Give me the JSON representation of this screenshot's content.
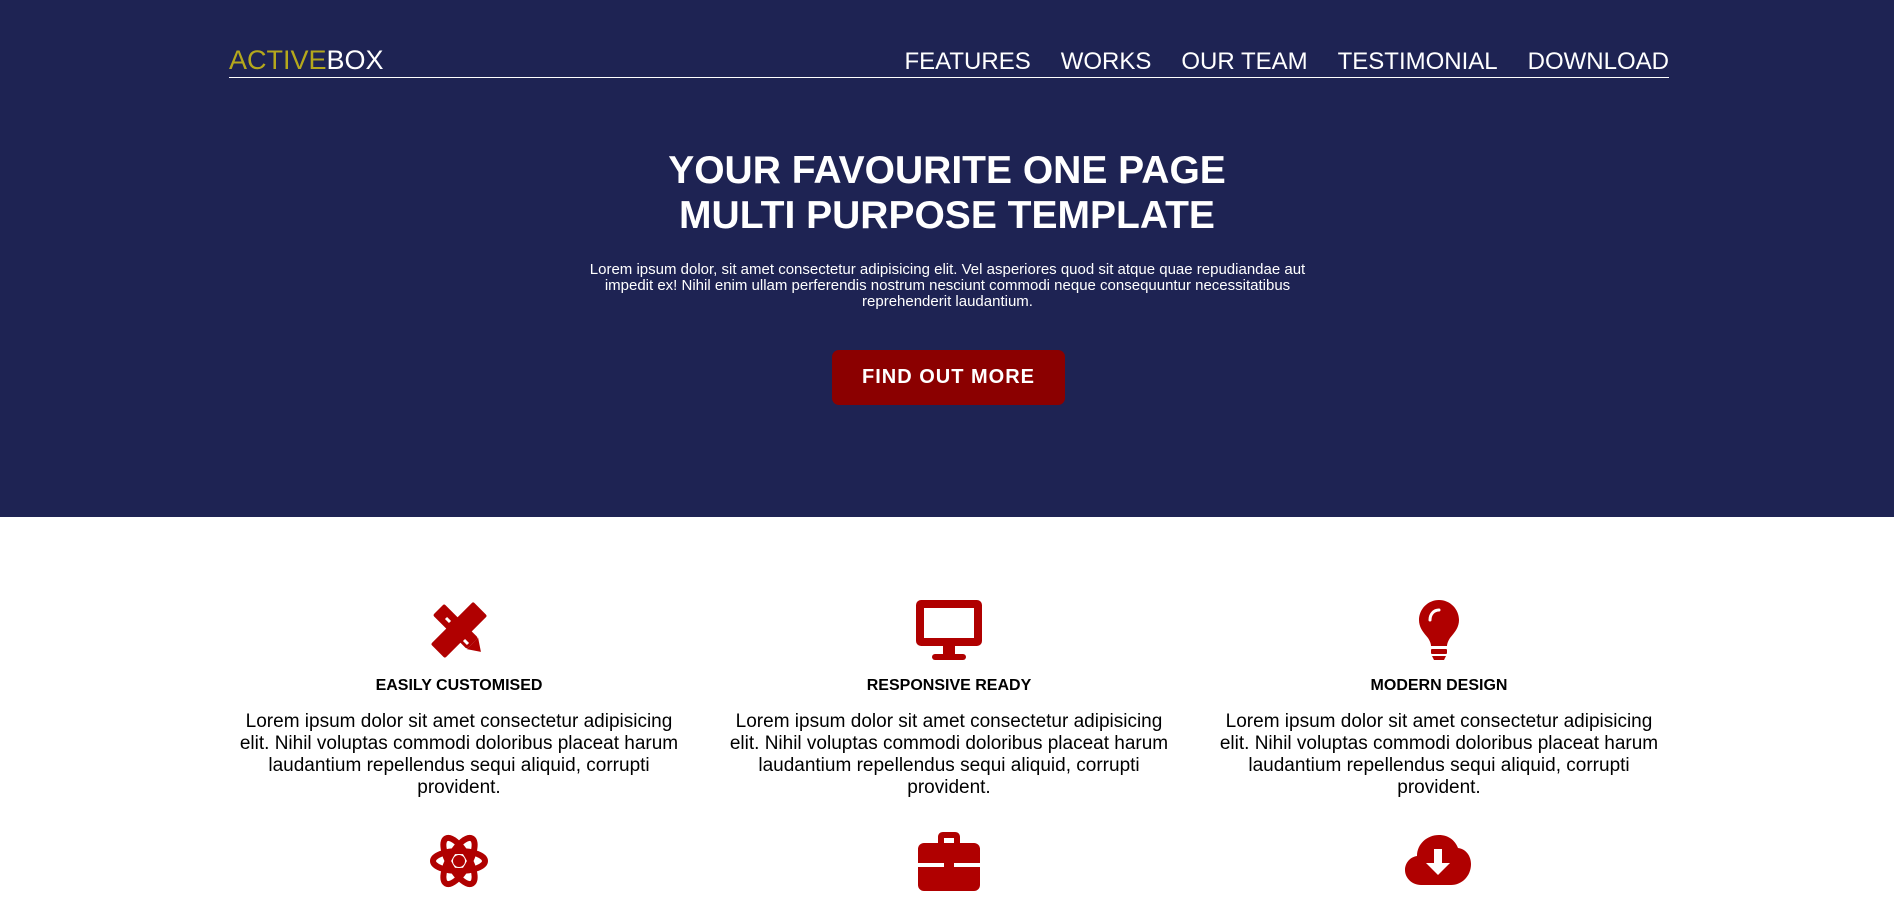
{
  "logo": {
    "part1": "ACTIVE",
    "part2": "BOX"
  },
  "nav": [
    "FEATURES",
    "WORKS",
    "OUR TEAM",
    "TESTIMONIAL",
    "DOWNLOAD"
  ],
  "hero": {
    "title_line1": "YOUR FAVOURITE ONE PAGE",
    "title_line2": "MULTI PURPOSE TEMPLATE",
    "text": "Lorem ipsum dolor, sit amet consectetur adipisicing elit. Vel asperiores quod sit atque quae repudiandae aut impedit ex! Nihil enim ullam perferendis nostrum nesciunt commodi neque consequuntur necessitatibus reprehenderit laudantium.",
    "cta": "FIND OUT MORE"
  },
  "features": [
    {
      "icon": "pencil-ruler-icon",
      "title": "EASILY CUSTOMISED",
      "text": "Lorem ipsum dolor sit amet consectetur adipisicing elit. Nihil voluptas commodi doloribus placeat harum laudantium repellendus sequi aliquid, corrupti provident."
    },
    {
      "icon": "desktop-icon",
      "title": "RESPONSIVE READY",
      "text": "Lorem ipsum dolor sit amet consectetur adipisicing elit. Nihil voluptas commodi doloribus placeat harum laudantium repellendus sequi aliquid, corrupti provident."
    },
    {
      "icon": "lightbulb-icon",
      "title": "MODERN DESIGN",
      "text": "Lorem ipsum dolor sit amet consectetur adipisicing elit. Nihil voluptas commodi doloribus placeat harum laudantium repellendus sequi aliquid, corrupti provident."
    },
    {
      "icon": "atom-icon"
    },
    {
      "icon": "briefcase-icon"
    },
    {
      "icon": "cloud-download-icon"
    }
  ],
  "colors": {
    "hero_bg": "#1e2353",
    "logo_accent": "#b5a81c",
    "accent_red": "#8b0000",
    "icon_red": "#b00000"
  }
}
